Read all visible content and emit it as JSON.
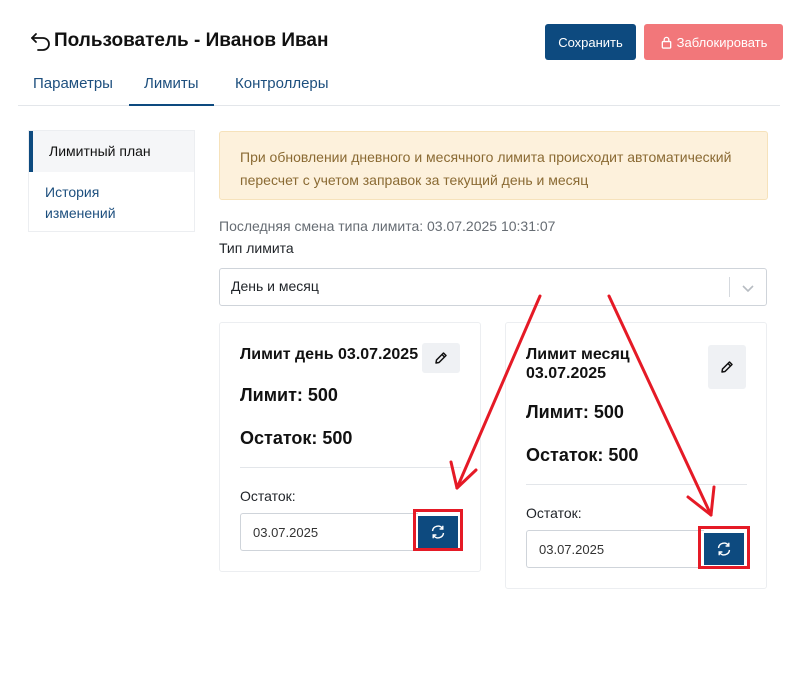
{
  "header": {
    "title": "Пользователь - Иванов Иван",
    "save_label": "Сохранить",
    "block_label": "Заблокировать"
  },
  "tabs": [
    {
      "label": "Параметры",
      "active": false
    },
    {
      "label": "Лимиты",
      "active": true
    },
    {
      "label": "Контроллеры",
      "active": false
    }
  ],
  "sidebar": {
    "items": [
      {
        "label": "Лимитный план",
        "active": true
      },
      {
        "label": "История изменений",
        "active": false
      }
    ]
  },
  "alert": {
    "text": "При обновлении дневного и месячного лимита происходит автоматический пересчет с учетом заправок за текущий день и месяц"
  },
  "limit": {
    "last_change": "Последняя смена типа лимита: 03.07.2025 10:31:07",
    "type_label": "Тип лимита",
    "type_value": "День и месяц"
  },
  "cards": [
    {
      "title": "Лимит день 03.07.2025",
      "limit_line": "Лимит: 500",
      "remaining_line": "Остаток: 500",
      "remaining_label": "Остаток:",
      "date": "03.07.2025"
    },
    {
      "title": "Лимит месяц 03.07.2025",
      "limit_line": "Лимит: 500",
      "remaining_line": "Остаток: 500",
      "remaining_label": "Остаток:",
      "date": "03.07.2025"
    }
  ],
  "colors": {
    "primary": "#0d4a7f",
    "danger": "#f2777a",
    "alert_bg": "#fdf1dc",
    "alert_text": "#8a6a33",
    "annotation": "#e51a26"
  },
  "icons": [
    "back-arrow-icon",
    "lock-icon",
    "chevron-down-icon",
    "pencil-icon",
    "refresh-icon"
  ]
}
